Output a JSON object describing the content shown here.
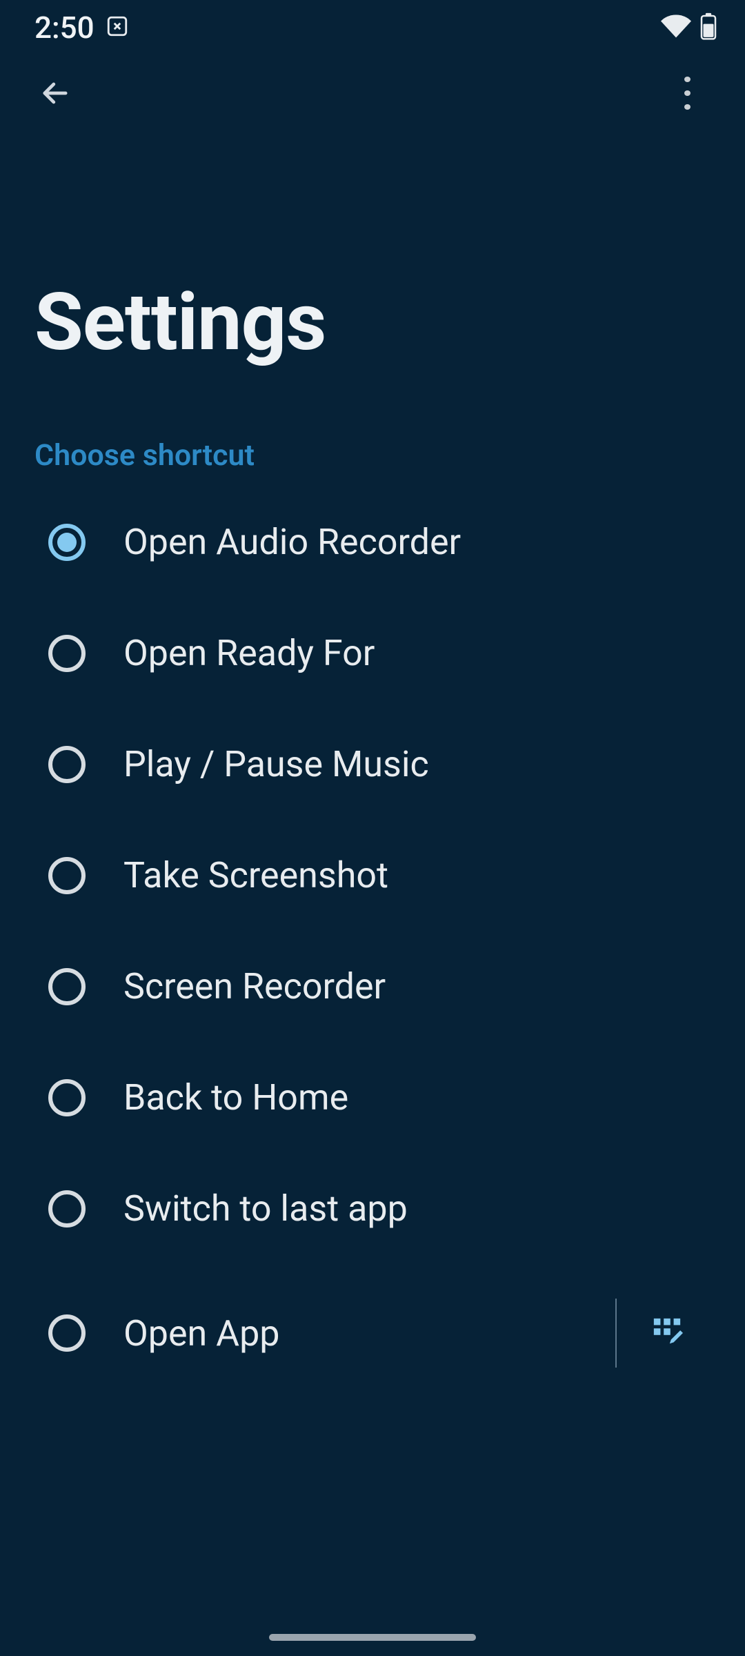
{
  "status": {
    "time": "2:50"
  },
  "header": {
    "title": "Settings"
  },
  "section": {
    "label": "Choose shortcut"
  },
  "options": [
    {
      "label": "Open Audio Recorder",
      "selected": true,
      "hasEdit": false
    },
    {
      "label": "Open Ready For",
      "selected": false,
      "hasEdit": false
    },
    {
      "label": "Play / Pause Music",
      "selected": false,
      "hasEdit": false
    },
    {
      "label": "Take Screenshot",
      "selected": false,
      "hasEdit": false
    },
    {
      "label": "Screen Recorder",
      "selected": false,
      "hasEdit": false
    },
    {
      "label": "Back to Home",
      "selected": false,
      "hasEdit": false
    },
    {
      "label": "Switch to last app",
      "selected": false,
      "hasEdit": false
    },
    {
      "label": "Open App",
      "selected": false,
      "hasEdit": true
    }
  ]
}
